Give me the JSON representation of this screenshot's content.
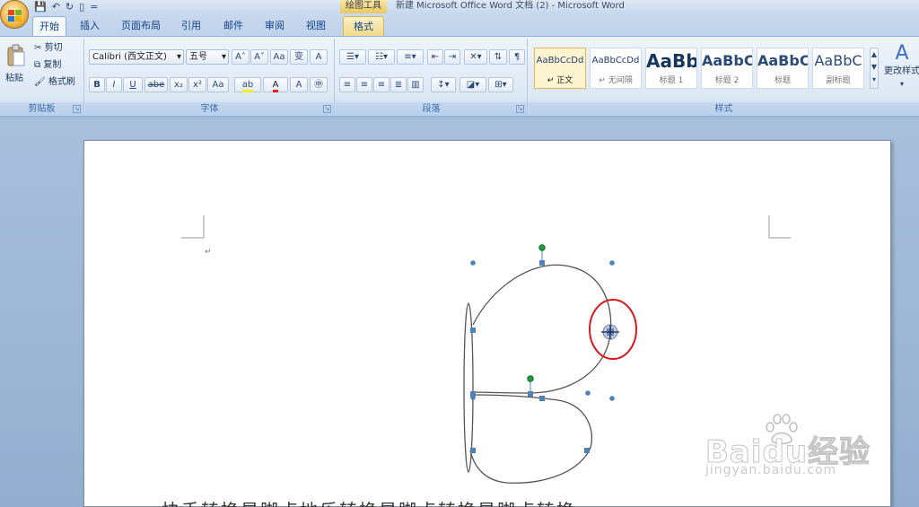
{
  "window": {
    "title": "新建 Microsoft Office Word 文档 (2) - Microsoft Word",
    "contextual_tab_title": "绘图工具"
  },
  "quick_access": {
    "save_icon": "save-icon",
    "undo_icon": "undo-icon",
    "redo_icon": "redo-icon",
    "new_icon": "new-document-icon",
    "customize": "="
  },
  "tabs": [
    {
      "label": "开始",
      "active": true
    },
    {
      "label": "插入"
    },
    {
      "label": "页面布局"
    },
    {
      "label": "引用"
    },
    {
      "label": "邮件"
    },
    {
      "label": "审阅"
    },
    {
      "label": "视图"
    },
    {
      "label": "格式",
      "contextual": true
    }
  ],
  "clipboard": {
    "group_label": "剪贴板",
    "paste_label": "粘贴",
    "cut_label": "剪切",
    "copy_label": "复制",
    "format_painter_label": "格式刷"
  },
  "font": {
    "group_label": "字体",
    "font_name": "Calibri (西文正文)",
    "font_size": "五号",
    "grow": "A˄",
    "shrink": "A˅",
    "clear": "Aa",
    "bold": "B",
    "italic": "I",
    "underline": "U",
    "strike": "abe",
    "subscript": "x₂",
    "superscript": "x²",
    "change_case": "Aa",
    "highlight": "ab",
    "font_color": "A",
    "char_border": "A",
    "enclose": "㊥",
    "phonetic": "wén",
    "char_shading": "变"
  },
  "paragraph": {
    "group_label": "段落"
  },
  "styles": {
    "group_label": "样式",
    "items": [
      {
        "sample": "AaBbCcDd",
        "name": "正文"
      },
      {
        "sample": "AaBbCcDd",
        "name": "无间隔"
      },
      {
        "sample": "AaBb",
        "name": "标题 1"
      },
      {
        "sample": "AaBbC",
        "name": "标题 2"
      },
      {
        "sample": "AaBbC",
        "name": "标题"
      },
      {
        "sample": "AaBbC",
        "name": "副标题"
      }
    ],
    "change_styles_label": "更改样式",
    "change_styles_icon": "A"
  },
  "document": {
    "paragraph_mark": "↵",
    "bottom_text": "快手转换星脚点地乐转换星脚点转换星脚点转换"
  },
  "watermark": {
    "logo": "Baidu经验",
    "url": "jingyan.baidu.com"
  },
  "colors": {
    "highlight_circle": "#d9191e",
    "handle_fill": "#4f81bd",
    "rotate_handle": "#1e9e3e",
    "shape_stroke": "#555555"
  }
}
